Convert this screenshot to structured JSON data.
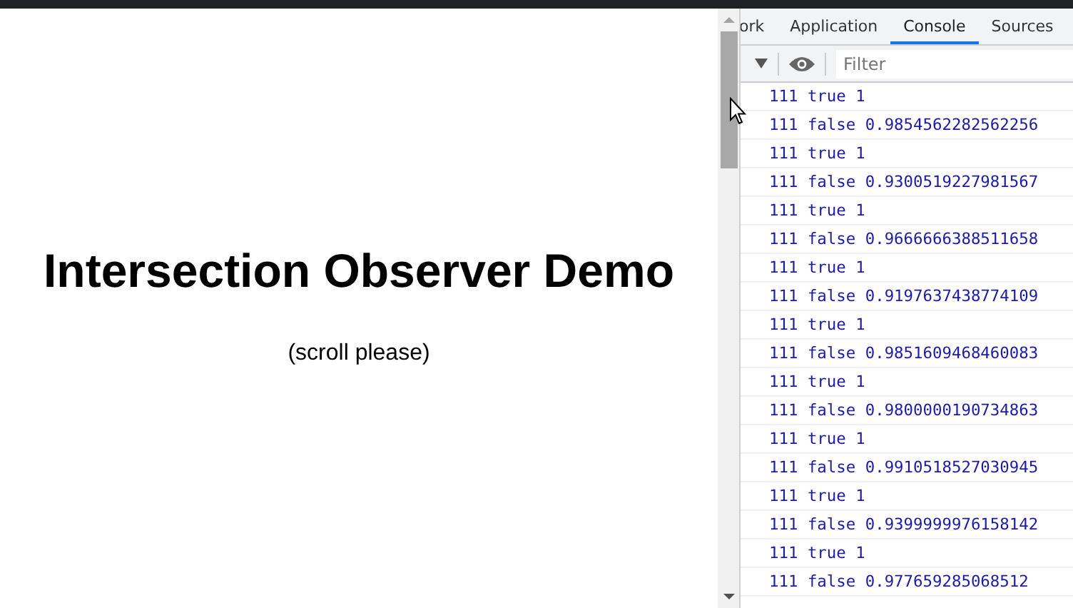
{
  "page": {
    "heading": "Intersection Observer Demo",
    "subtitle": "(scroll please)"
  },
  "devtools": {
    "tabs": [
      {
        "label": "ork",
        "selected": false
      },
      {
        "label": "Application",
        "selected": false
      },
      {
        "label": "Console",
        "selected": true
      },
      {
        "label": "Sources",
        "selected": false
      }
    ],
    "filter": {
      "placeholder": "Filter"
    },
    "console_lines": [
      "111 true 1",
      "111 false 0.9854562282562256",
      "111 true 1",
      "111 false 0.9300519227981567",
      "111 true 1",
      "111 false 0.9666666388511658",
      "111 true 1",
      "111 false 0.9197637438774109",
      "111 true 1",
      "111 false 0.9851609468460083",
      "111 true 1",
      "111 false 0.9800000190734863",
      "111 true 1",
      "111 false 0.9910518527030945",
      "111 true 1",
      "111 false 0.9399999976158142",
      "111 true 1",
      "111 false 0.977659285068512"
    ]
  }
}
